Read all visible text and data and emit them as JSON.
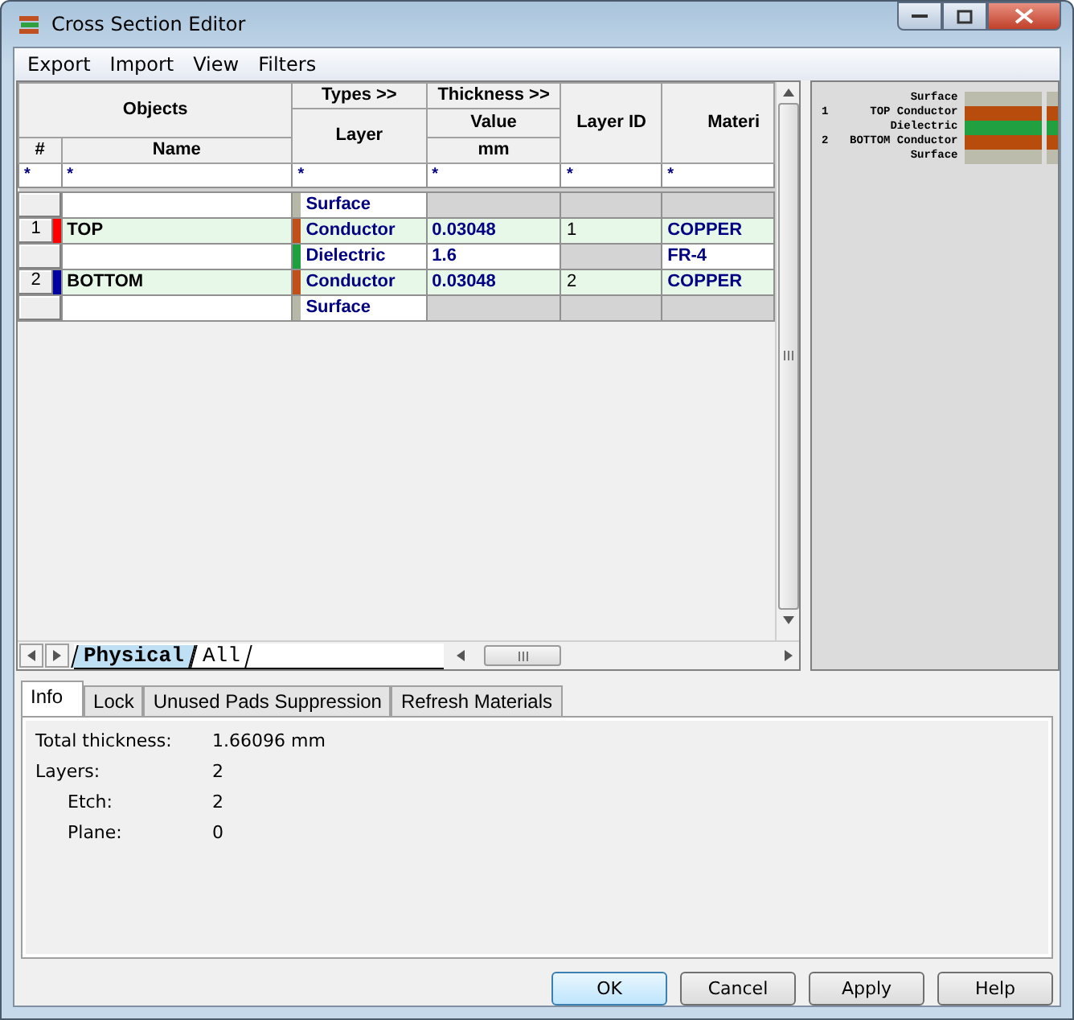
{
  "window": {
    "title": "Cross Section Editor"
  },
  "menu": [
    "Export",
    "Import",
    "View",
    "Filters"
  ],
  "table": {
    "group_headers": [
      "Objects",
      "Types >>",
      "Thickness >>"
    ],
    "columns": [
      "#",
      "Name",
      "Layer",
      "Value",
      "Layer ID",
      "Materi"
    ],
    "unit": "mm",
    "filters": [
      "*",
      "*",
      "*",
      "*",
      "*",
      "*"
    ],
    "rows": [
      {
        "kind": "surface",
        "layer": "Surface",
        "color": "#b8b8a8"
      },
      {
        "kind": "conductor",
        "number": "1",
        "marker": {
          "color": "#ff0000"
        },
        "name": "TOP",
        "layer": "Conductor",
        "color": "#c0501a",
        "value": "0.03048",
        "layer_id": "1",
        "material": "COPPER"
      },
      {
        "kind": "dielectric",
        "layer": "Dielectric",
        "color": "#1fa040",
        "value": "1.6",
        "material": "FR-4"
      },
      {
        "kind": "conductor",
        "number": "2",
        "marker": {
          "color": "#0000a0"
        },
        "name": "BOTTOM",
        "layer": "Conductor",
        "color": "#c0501a",
        "value": "0.03048",
        "layer_id": "2",
        "material": "COPPER"
      },
      {
        "kind": "surface",
        "layer": "Surface",
        "color": "#b8b8a8"
      }
    ]
  },
  "sheet_tabs": [
    {
      "label": "Physical",
      "selected": true
    },
    {
      "label": "All",
      "selected": false
    }
  ],
  "preview": [
    {
      "label": "Surface",
      "color": "#bcbcac"
    },
    {
      "number": "1",
      "label": "TOP Conductor",
      "color": "#b84c0c"
    },
    {
      "label": "Dielectric",
      "color": "#20a040"
    },
    {
      "number": "2",
      "label": "BOTTOM Conductor",
      "color": "#b84c0c"
    },
    {
      "label": "Surface",
      "color": "#bcbcac"
    }
  ],
  "info_tabs": [
    {
      "label": "Info",
      "selected": true
    },
    {
      "label": "Lock",
      "selected": false
    },
    {
      "label": "Unused Pads Suppression",
      "selected": false
    },
    {
      "label": "Refresh Materials",
      "selected": false
    }
  ],
  "info": [
    {
      "label": "Total thickness:",
      "value": "1.66096 mm",
      "indent": false
    },
    {
      "label": "Layers:",
      "value": "2",
      "indent": false
    },
    {
      "label": "Etch:",
      "value": "2",
      "indent": true
    },
    {
      "label": "Plane:",
      "value": "0",
      "indent": true
    }
  ],
  "buttons": [
    {
      "label": "OK",
      "default": true
    },
    {
      "label": "Cancel",
      "default": false
    },
    {
      "label": "Apply",
      "default": false
    },
    {
      "label": "Help",
      "default": false
    }
  ]
}
